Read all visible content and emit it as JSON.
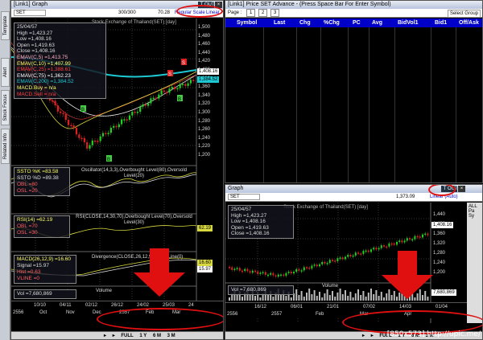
{
  "left_window": {
    "title": "[Link1] Graph",
    "counter": "300/300",
    "price_display": "70.28",
    "scale_regular": "Regular Scale",
    "scale_linear": "Linear",
    "symbol": "SET",
    "chart_title": "Stock Exchange of Thailand(SET) [day]",
    "info_box": {
      "date": "25/04/57",
      "high": "High =1,423.27",
      "low": "Low =1,408.16",
      "open": "Open =1,419.63",
      "close": "Close =1,408.16",
      "ema1": "EMAV(C,5) =1,413.75",
      "ema2": "EMAV(C,10) =1,407.99",
      "ema3": "EMAV(C,25) =1,388.61",
      "ema4": "EMAV(C,75) =1,362.23",
      "ema5": "EMAV(C,200) =1,384.52",
      "macd_buy": "MACD.Buy = n/a",
      "macd_sell": "MACD.Sell = n/a"
    },
    "price_axis": [
      "1,500",
      "1,480",
      "1,460",
      "1,440",
      "1,420",
      "1,400",
      "1,380",
      "1,360",
      "1,340",
      "1,320",
      "1,300",
      "1,280",
      "1,260",
      "1,240",
      "1,220",
      "1,200"
    ],
    "last_price_tag": "1,408.16",
    "ema_tag": "1,384.52",
    "signal_sell": "S",
    "signal_buy": "B",
    "osc_box": {
      "k": "SSTO %K =83.58",
      "d": "SSTO %D =89.38",
      "obl": "OBL =80",
      "osl": "OSL =20"
    },
    "osc_title": "Oscillator(14,3,3),Overbought Level(80),Oversold Level(20)",
    "rsi_box": {
      "rsi": "RSI(14) =62.19",
      "obl": "OBL =70",
      "osl": "OSL =30"
    },
    "rsi_title": "RSI(CLOSE,14,30,70),Overbought Level(70),Oversold Level(30)",
    "rsi_tag": "62.19",
    "macd_box": {
      "macd": "MACD(26,12,9) =16.60",
      "signal": "Signal =15.97",
      "hist": "Hist =0.63",
      "vline": "VLINE =0"
    },
    "macd_title": "Divergence(CLOSE,26,12,9),Value Line(0)",
    "macd_tag1": "16.60",
    "macd_tag2": "15.97",
    "vol_box": "Vol =7,680,869",
    "vol_title": "Volume",
    "time_ticks": [
      "10/10",
      "04/11",
      "02/12",
      "26/12",
      "24/02",
      "25/03",
      "24"
    ],
    "month_row": [
      "2556",
      "Oct",
      "Nov",
      "Dec",
      "2557",
      "Feb",
      "Mar"
    ],
    "timeframes": [
      "FULL",
      "1 Y",
      "6 M",
      "3 M"
    ]
  },
  "vertical_tabs": [
    "Template",
    "Alert",
    "Stock Focus",
    "Related Info"
  ],
  "right_top_window": {
    "title": "[Link1] Price SET Advance - (Press Space Bar For Enter Symbol)",
    "page_label": "Page :",
    "pages": [
      "1",
      "2",
      "3"
    ],
    "select_group": "Select Group",
    "columns": [
      "Symbol",
      "Last",
      "Chg",
      "%Chg",
      "PC",
      "Avg",
      "BidVol1",
      "Bid1",
      "Off/Ask"
    ]
  },
  "right_bottom_window": {
    "title": "Graph",
    "symbol": "SET",
    "counter": "1,373.09",
    "scale_label": "Linear (Auto)",
    "chart_title": "Stock Exchange of Thailand(SET) [day]",
    "info_box": {
      "date": "25/04/57",
      "high": "High =1,423.27",
      "low": "Low =1,408.16",
      "open": "Open =1,419.63",
      "close": "Close =1,408.16"
    },
    "price_axis": [
      "1,440",
      "1,400",
      "1,360",
      "1,320",
      "1,280",
      "1,240",
      "1,200"
    ],
    "last_price_tag": "1,408.16",
    "vol_box": "Vol =7,680,869",
    "vol_title": "Volume",
    "vol_tag": "7,680,869",
    "side_labels": [
      "ALL",
      "Pa",
      "Sy"
    ],
    "time_ticks": [
      "16/12",
      "06/01",
      "21/01",
      "07/02",
      "14/03",
      "01/04"
    ],
    "month_row": [
      "2556",
      "2557",
      "Feb",
      "Mar",
      "Apr"
    ],
    "timeframes": [
      "FULL",
      "1 Y",
      "6 M",
      "3 M"
    ]
  },
  "watermark": "[850x573] http://upic.me/",
  "colors": {
    "ema_cyan": "#1ec8d2",
    "candle_green": "#22d022",
    "candle_red": "#e02020",
    "highlight": "#e01010",
    "header_blue": "#0000c8"
  }
}
